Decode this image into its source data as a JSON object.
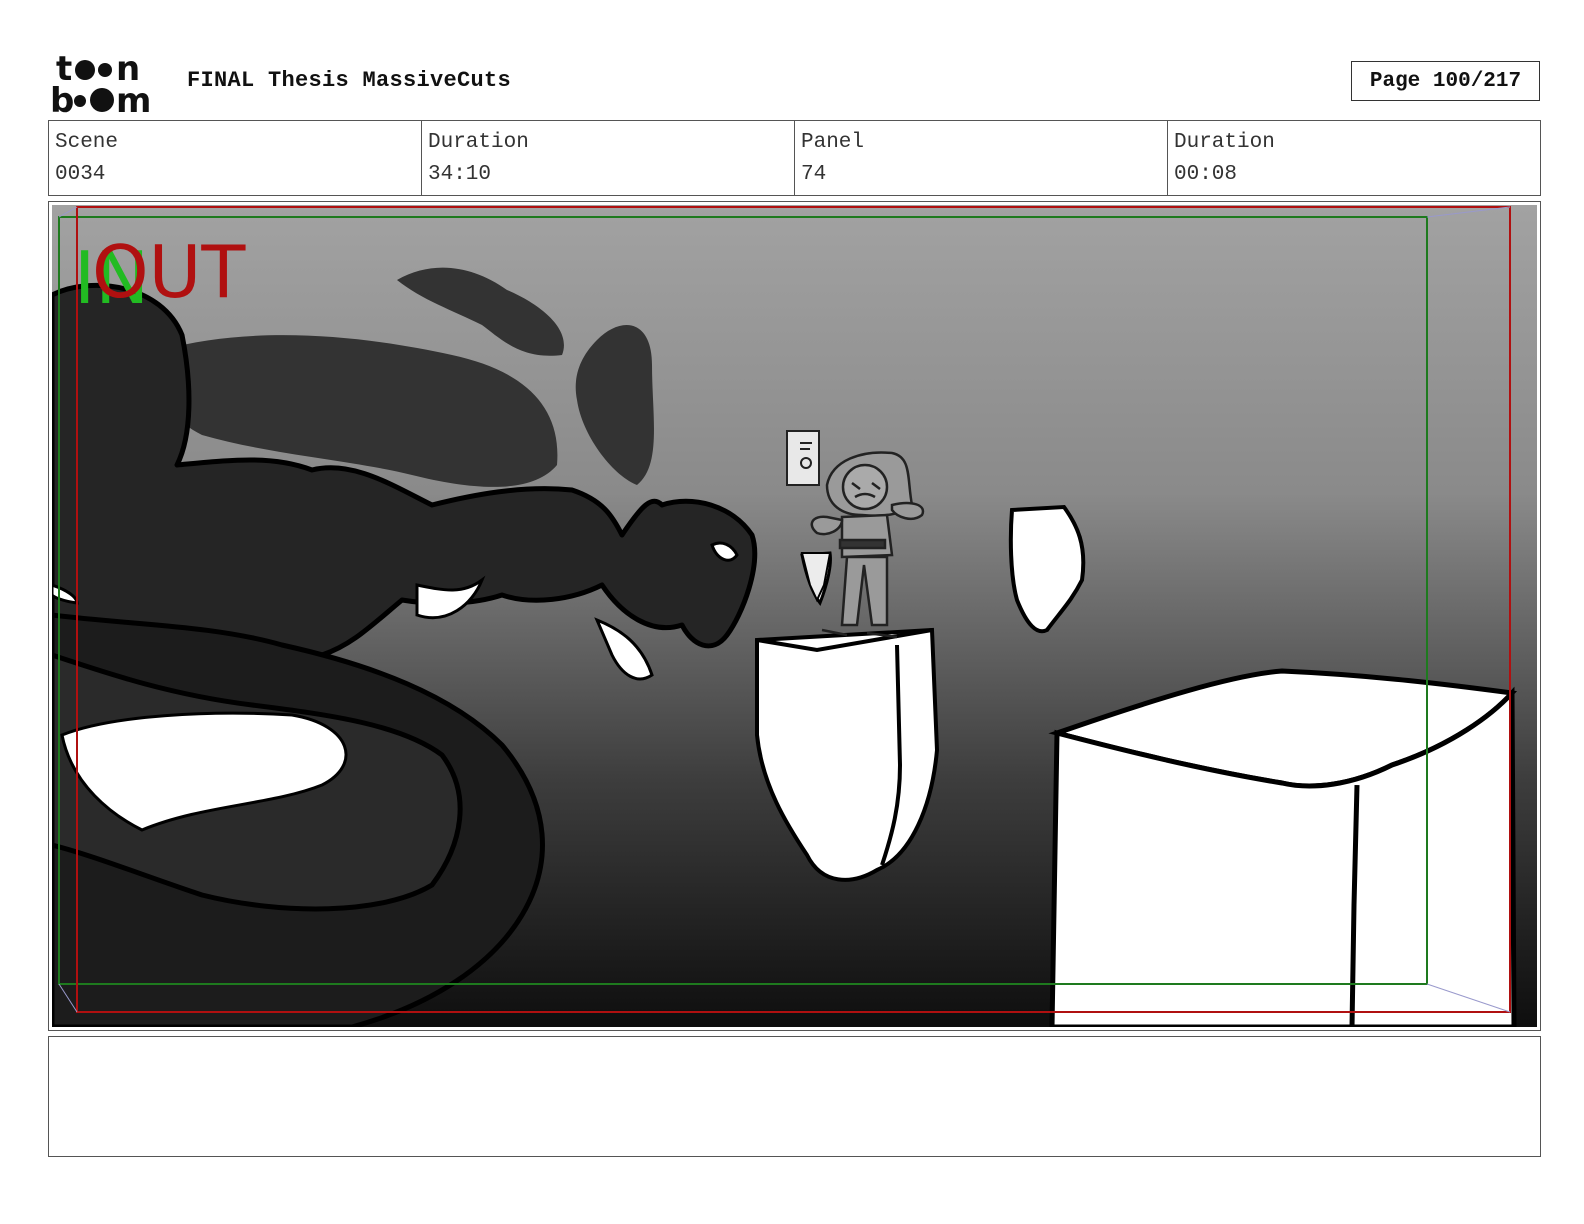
{
  "header": {
    "logo_text": "toon boom",
    "title": "FINAL Thesis MassiveCuts",
    "page": "Page 100/217"
  },
  "info": {
    "scene_label": "Scene",
    "scene_value": "0034",
    "duration_label": "Duration",
    "duration_value": "34:10",
    "panel_label": "Panel",
    "panel_value": "74",
    "panel_duration_label": "Duration",
    "panel_duration_value": "00:08"
  },
  "panel": {
    "in_label": "IN",
    "out_label": "OUT",
    "safe_frame_color": "#1e7a1e",
    "camera_frame_color": "#b01010"
  },
  "notes": {
    "text": ""
  }
}
